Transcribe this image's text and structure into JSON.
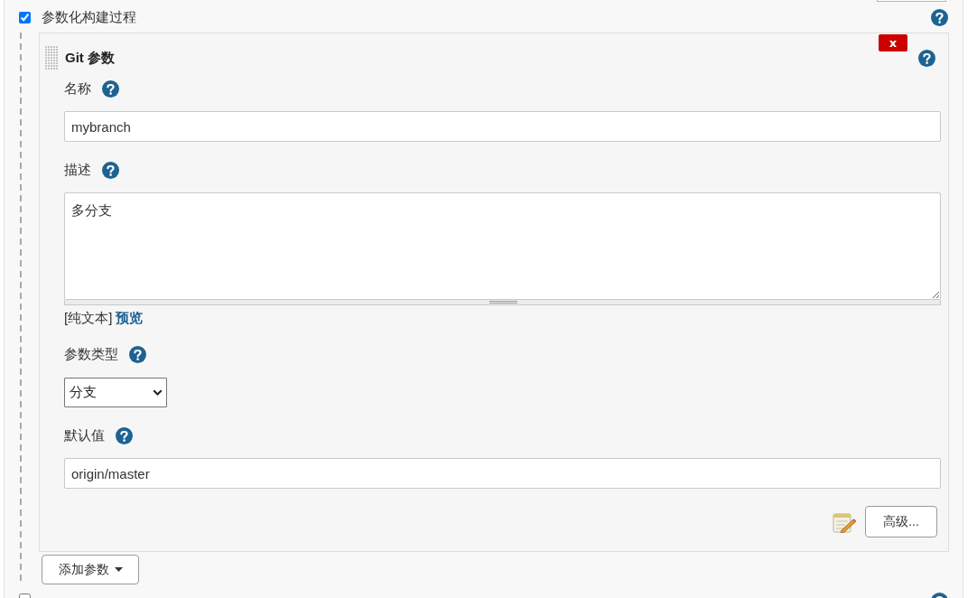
{
  "section": {
    "label": "参数化构建过程",
    "checked": true
  },
  "parameter": {
    "title": "Git 参数",
    "delete_label": "x",
    "fields": [
      {
        "kind": "text",
        "label": "名称",
        "value": "mybranch"
      },
      {
        "kind": "textarea",
        "label": "描述",
        "value": "多分支",
        "format": "[纯文本]",
        "preview_link": "预览"
      },
      {
        "kind": "select",
        "label": "参数类型",
        "value": "分支"
      },
      {
        "kind": "text",
        "label": "默认值",
        "value": "origin/master"
      }
    ],
    "advanced_button": "高级..."
  },
  "add_button": "添加参数",
  "next_section": {
    "checked": false
  }
}
